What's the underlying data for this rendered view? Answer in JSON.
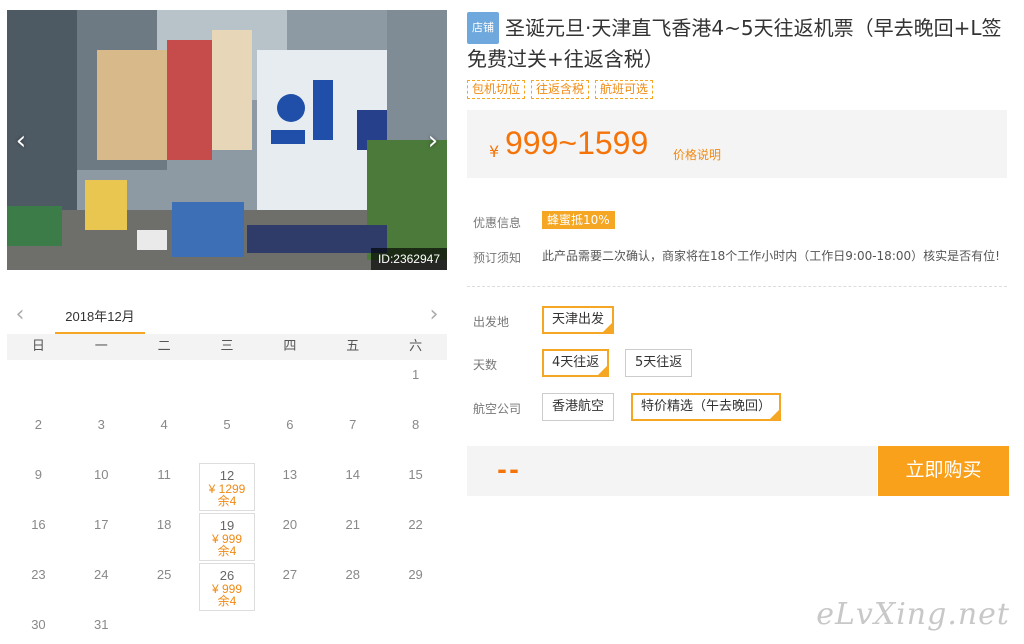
{
  "photo": {
    "id_label": "ID:2362947",
    "prev_icon": "chevron-left-icon",
    "next_icon": "chevron-right-icon"
  },
  "calendar": {
    "month": "2018年12月",
    "weekdays": [
      "日",
      "一",
      "二",
      "三",
      "四",
      "五",
      "六"
    ],
    "leading_blanks": 6,
    "days": [
      {
        "d": "1"
      },
      {
        "d": "2"
      },
      {
        "d": "3"
      },
      {
        "d": "4"
      },
      {
        "d": "5"
      },
      {
        "d": "6"
      },
      {
        "d": "7"
      },
      {
        "d": "8"
      },
      {
        "d": "9"
      },
      {
        "d": "10"
      },
      {
        "d": "11"
      },
      {
        "d": "12",
        "price": "¥ 1299",
        "stock": "余4"
      },
      {
        "d": "13"
      },
      {
        "d": "14"
      },
      {
        "d": "15"
      },
      {
        "d": "16"
      },
      {
        "d": "17"
      },
      {
        "d": "18"
      },
      {
        "d": "19",
        "price": "¥ 999",
        "stock": "余4"
      },
      {
        "d": "20"
      },
      {
        "d": "21"
      },
      {
        "d": "22"
      },
      {
        "d": "23"
      },
      {
        "d": "24"
      },
      {
        "d": "25"
      },
      {
        "d": "26",
        "price": "¥ 999",
        "stock": "余4"
      },
      {
        "d": "27"
      },
      {
        "d": "28"
      },
      {
        "d": "29"
      },
      {
        "d": "30"
      },
      {
        "d": "31"
      }
    ]
  },
  "product": {
    "shop_tag": "店铺",
    "title": "圣诞元旦·天津直飞香港4~5天往返机票（早去晚回+L签免费过关+往返含税）",
    "tags": [
      "包机切位",
      "往返含税",
      "航班可选"
    ],
    "currency": "¥",
    "price_range": "999~1599",
    "price_note": "价格说明"
  },
  "info": {
    "discount_label": "优惠信息",
    "discount_value": "蜂蜜抵10%",
    "notice_label": "预订须知",
    "notice_text": "此产品需要二次确认，商家将在18个工作小时内（工作日9:00-18:00）核实是否有位!"
  },
  "options": {
    "departure_label": "出发地",
    "departure": "天津出发",
    "days_label": "天数",
    "days_a": "4天往返",
    "days_b": "5天往返",
    "airline_label": "航空公司",
    "airline_a": "香港航空",
    "airline_b": "特价精选（午去晚回）"
  },
  "buy": {
    "total": "--",
    "button": "立即购买"
  },
  "watermark": "eLvXing.net",
  "colors": {
    "accent": "#f5a623",
    "price": "#f5740a",
    "buy_button": "#f9a11b"
  }
}
